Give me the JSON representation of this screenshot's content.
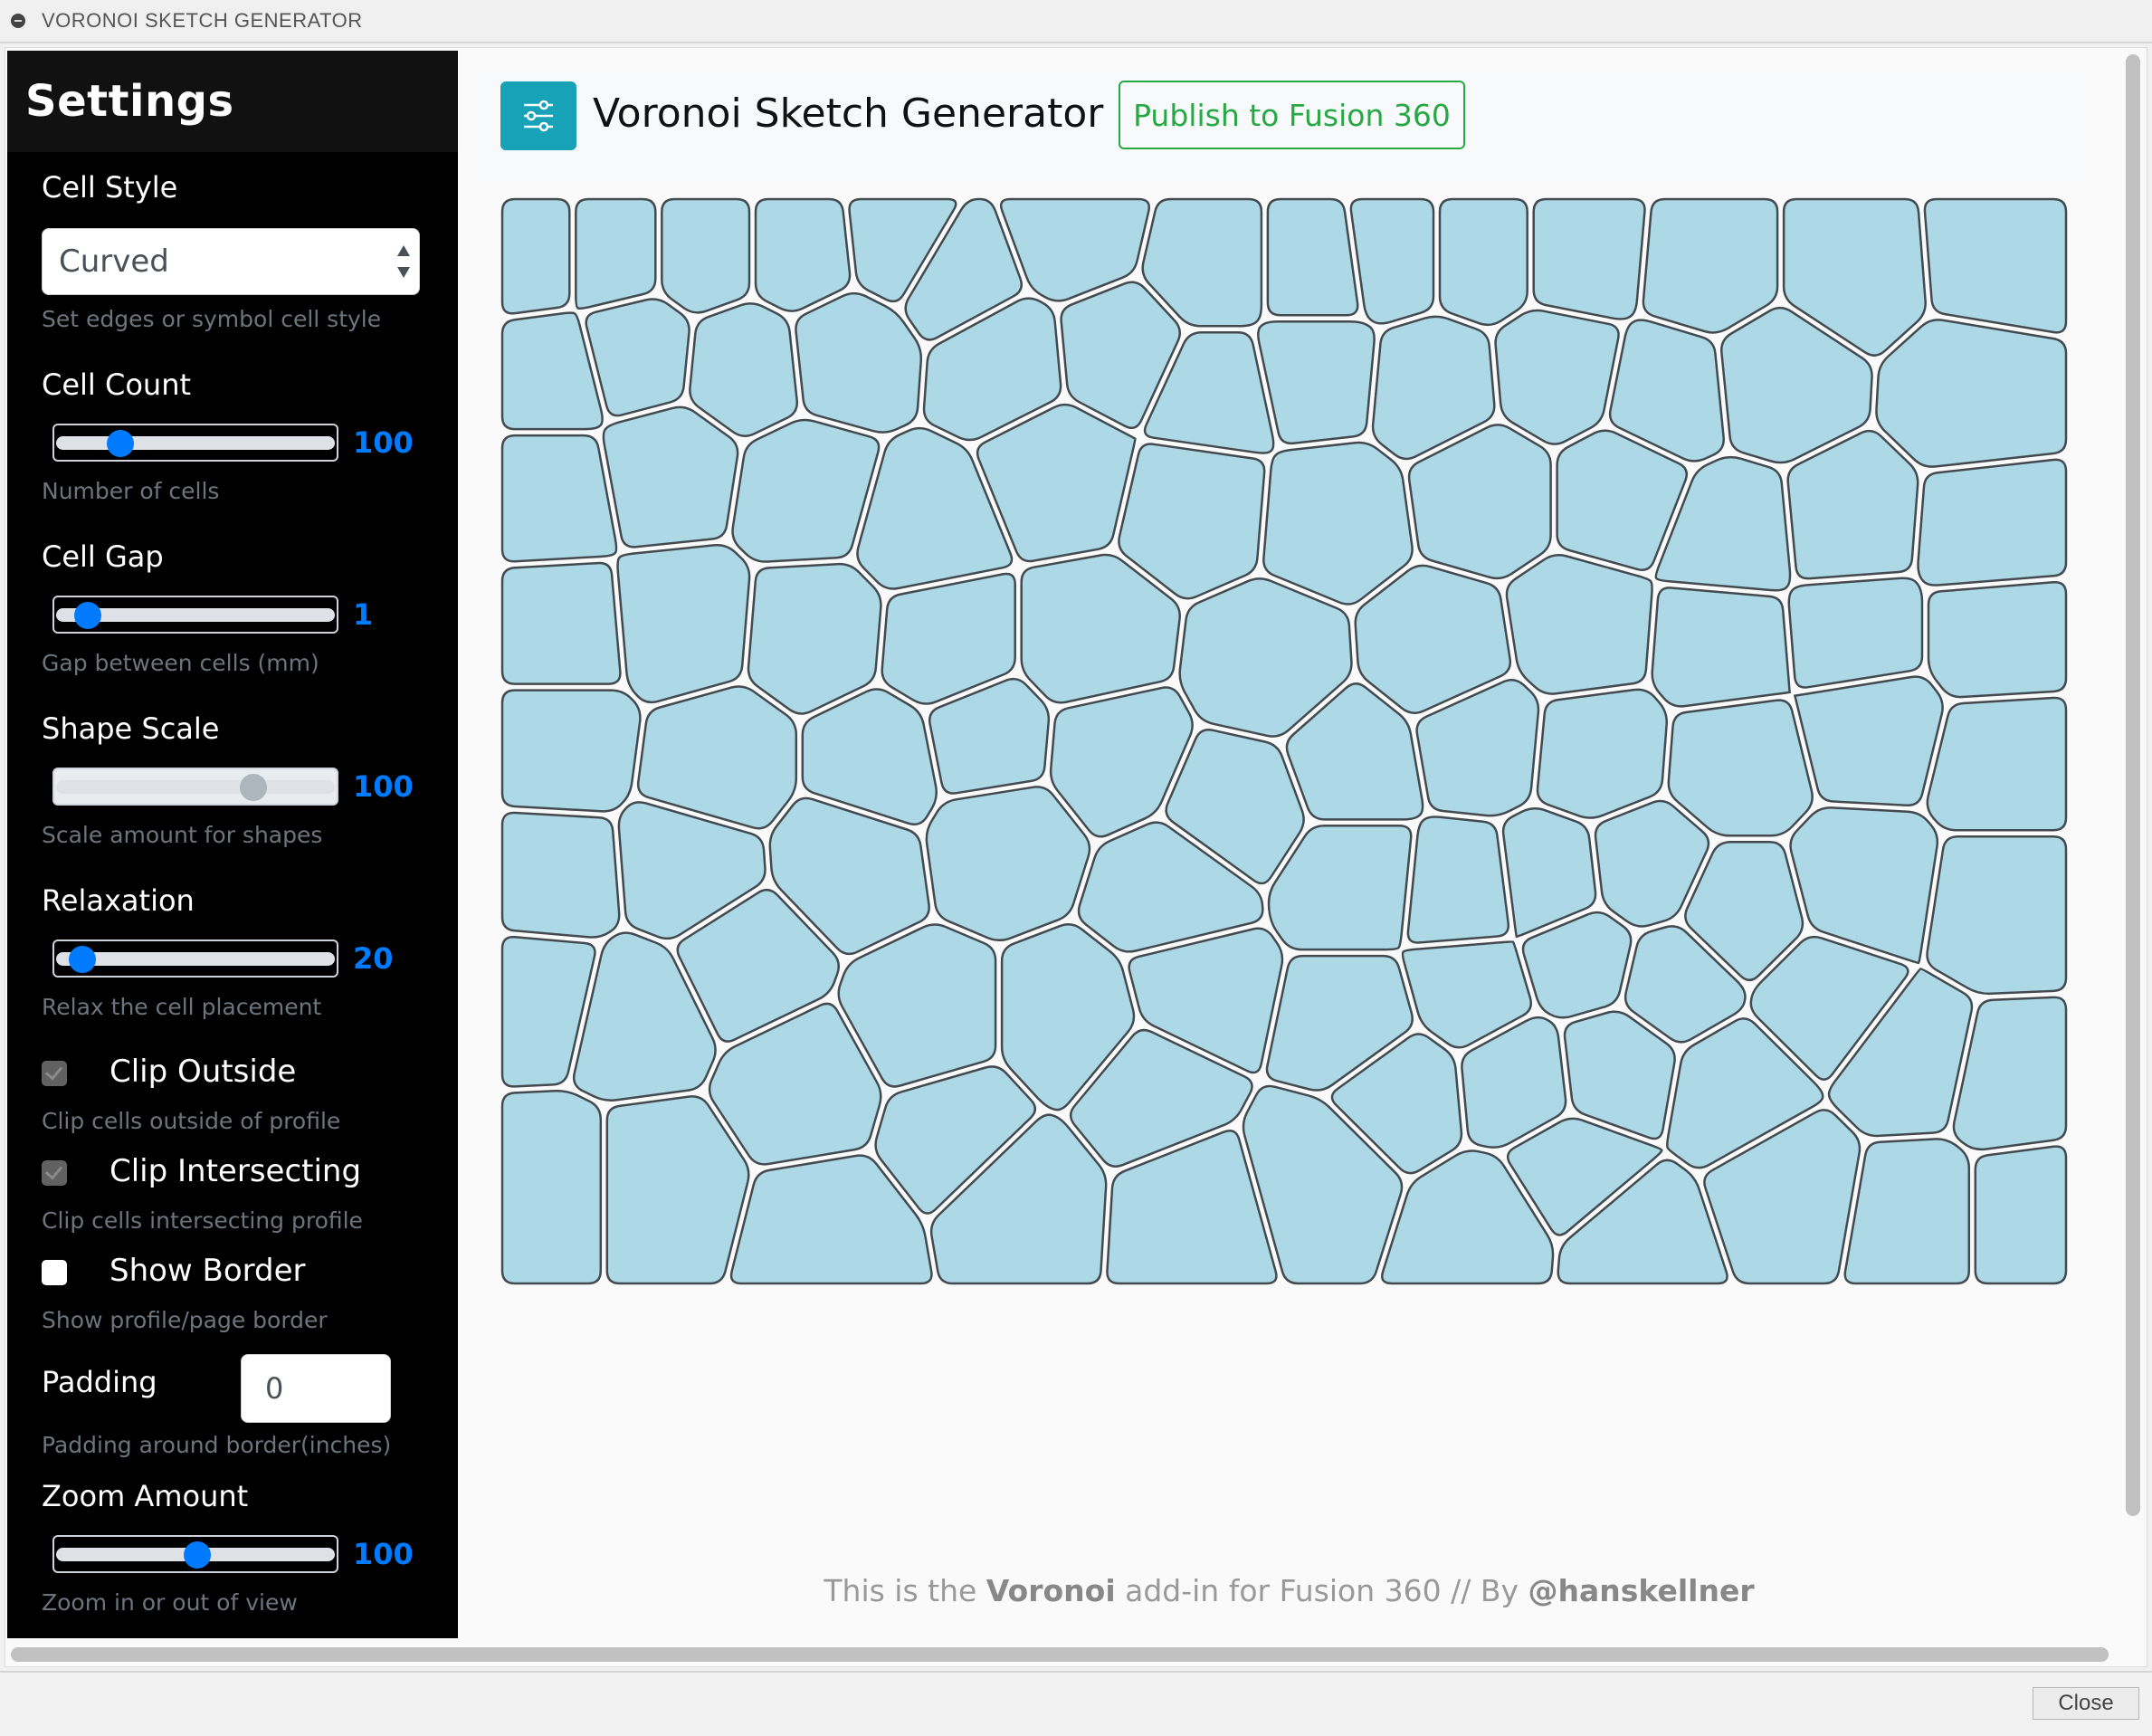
{
  "window": {
    "title": "VORONOI SKETCH GENERATOR",
    "close_label": "Close"
  },
  "sidebar": {
    "title": "Settings",
    "cell_style": {
      "label": "Cell Style",
      "value": "Curved",
      "hint": "Set edges or symbol cell style"
    },
    "cell_count": {
      "label": "Cell Count",
      "value": "100",
      "fraction": 0.2,
      "hint": "Number of cells"
    },
    "cell_gap": {
      "label": "Cell Gap",
      "value": "1",
      "fraction": 0.07,
      "hint": "Gap between cells (mm)"
    },
    "shape_scale": {
      "label": "Shape Scale",
      "value": "100",
      "fraction": 0.72,
      "hint": "Scale amount for shapes",
      "disabled": true
    },
    "relaxation": {
      "label": "Relaxation",
      "value": "20",
      "fraction": 0.05,
      "hint": "Relax the cell placement"
    },
    "clip_outside": {
      "label": "Clip Outside",
      "checked": true,
      "hint": "Clip cells outside of profile"
    },
    "clip_intersecting": {
      "label": "Clip Intersecting",
      "checked": true,
      "hint": "Clip cells intersecting profile"
    },
    "show_border": {
      "label": "Show Border",
      "checked": false,
      "hint": "Show profile/page border"
    },
    "padding": {
      "label": "Padding",
      "value": "0",
      "hint": "Padding around border(inches)"
    },
    "zoom": {
      "label": "Zoom Amount",
      "value": "100",
      "fraction": 0.5,
      "hint": "Zoom in or out of view"
    }
  },
  "header": {
    "title": "Voronoi Sketch Generator",
    "publish_label": "Publish to Fusion 360",
    "icon": "sliders-icon"
  },
  "footer": {
    "prefix": "This is the ",
    "bold1": "Voronoi",
    "middle": " add-in for Fusion 360 // By ",
    "bold2": "@hanskellner"
  },
  "colors": {
    "cell_fill": "#add8e6",
    "cell_stroke": "#444b50",
    "accent": "#007bff",
    "publish": "#28a745",
    "app_icon": "#17a2b8"
  },
  "diagram": {
    "cell_style": "curved",
    "seeds": [
      [
        0.02,
        0.05
      ],
      [
        0.07,
        0.05
      ],
      [
        0.13,
        0.05
      ],
      [
        0.19,
        0.05
      ],
      [
        0.255,
        0.04
      ],
      [
        0.29,
        0.07
      ],
      [
        0.365,
        0.03
      ],
      [
        0.455,
        0.06
      ],
      [
        0.52,
        0.06
      ],
      [
        0.57,
        0.05
      ],
      [
        0.625,
        0.05
      ],
      [
        0.69,
        0.05
      ],
      [
        0.77,
        0.06
      ],
      [
        0.865,
        0.06
      ],
      [
        0.955,
        0.05
      ],
      [
        0.03,
        0.16
      ],
      [
        0.085,
        0.14
      ],
      [
        0.155,
        0.15
      ],
      [
        0.22,
        0.14
      ],
      [
        0.32,
        0.15
      ],
      [
        0.395,
        0.14
      ],
      [
        0.455,
        0.18
      ],
      [
        0.52,
        0.16
      ],
      [
        0.595,
        0.17
      ],
      [
        0.675,
        0.16
      ],
      [
        0.745,
        0.18
      ],
      [
        0.815,
        0.17
      ],
      [
        0.94,
        0.18
      ],
      [
        0.03,
        0.27
      ],
      [
        0.105,
        0.25
      ],
      [
        0.195,
        0.27
      ],
      [
        0.27,
        0.3
      ],
      [
        0.355,
        0.25
      ],
      [
        0.445,
        0.28
      ],
      [
        0.53,
        0.29
      ],
      [
        0.63,
        0.27
      ],
      [
        0.715,
        0.27
      ],
      [
        0.786,
        0.31
      ],
      [
        0.86,
        0.3
      ],
      [
        0.95,
        0.31
      ],
      [
        0.035,
        0.4
      ],
      [
        0.115,
        0.39
      ],
      [
        0.2,
        0.4
      ],
      [
        0.285,
        0.41
      ],
      [
        0.375,
        0.41
      ],
      [
        0.49,
        0.43
      ],
      [
        0.6,
        0.42
      ],
      [
        0.69,
        0.4
      ],
      [
        0.78,
        0.41
      ],
      [
        0.865,
        0.4
      ],
      [
        0.955,
        0.4
      ],
      [
        0.035,
        0.5
      ],
      [
        0.14,
        0.52
      ],
      [
        0.24,
        0.52
      ],
      [
        0.31,
        0.5
      ],
      [
        0.39,
        0.51
      ],
      [
        0.47,
        0.56
      ],
      [
        0.545,
        0.52
      ],
      [
        0.625,
        0.5
      ],
      [
        0.7,
        0.51
      ],
      [
        0.79,
        0.52
      ],
      [
        0.875,
        0.49
      ],
      [
        0.96,
        0.52
      ],
      [
        0.03,
        0.63
      ],
      [
        0.12,
        0.62
      ],
      [
        0.22,
        0.61
      ],
      [
        0.32,
        0.59
      ],
      [
        0.43,
        0.64
      ],
      [
        0.545,
        0.63
      ],
      [
        0.615,
        0.64
      ],
      [
        0.67,
        0.63
      ],
      [
        0.73,
        0.62
      ],
      [
        0.79,
        0.66
      ],
      [
        0.87,
        0.63
      ],
      [
        0.96,
        0.65
      ],
      [
        0.024,
        0.73
      ],
      [
        0.085,
        0.75
      ],
      [
        0.155,
        0.7
      ],
      [
        0.27,
        0.76
      ],
      [
        0.365,
        0.76
      ],
      [
        0.445,
        0.73
      ],
      [
        0.545,
        0.76
      ],
      [
        0.62,
        0.73
      ],
      [
        0.69,
        0.7
      ],
      [
        0.75,
        0.72
      ],
      [
        0.845,
        0.74
      ],
      [
        0.965,
        0.82
      ],
      [
        0.195,
        0.82
      ],
      [
        0.29,
        0.86
      ],
      [
        0.415,
        0.82
      ],
      [
        0.575,
        0.82
      ],
      [
        0.65,
        0.81
      ],
      [
        0.71,
        0.8
      ],
      [
        0.79,
        0.82
      ],
      [
        0.9,
        0.8
      ],
      [
        0.03,
        0.91
      ],
      [
        0.1,
        0.91
      ],
      [
        0.21,
        0.95
      ],
      [
        0.33,
        0.92
      ],
      [
        0.445,
        0.93
      ],
      [
        0.52,
        0.9
      ],
      [
        0.63,
        0.95
      ],
      [
        0.685,
        0.9
      ],
      [
        0.72,
        0.96
      ],
      [
        0.825,
        0.91
      ],
      [
        0.905,
        0.93
      ],
      [
        0.975,
        0.93
      ]
    ]
  }
}
